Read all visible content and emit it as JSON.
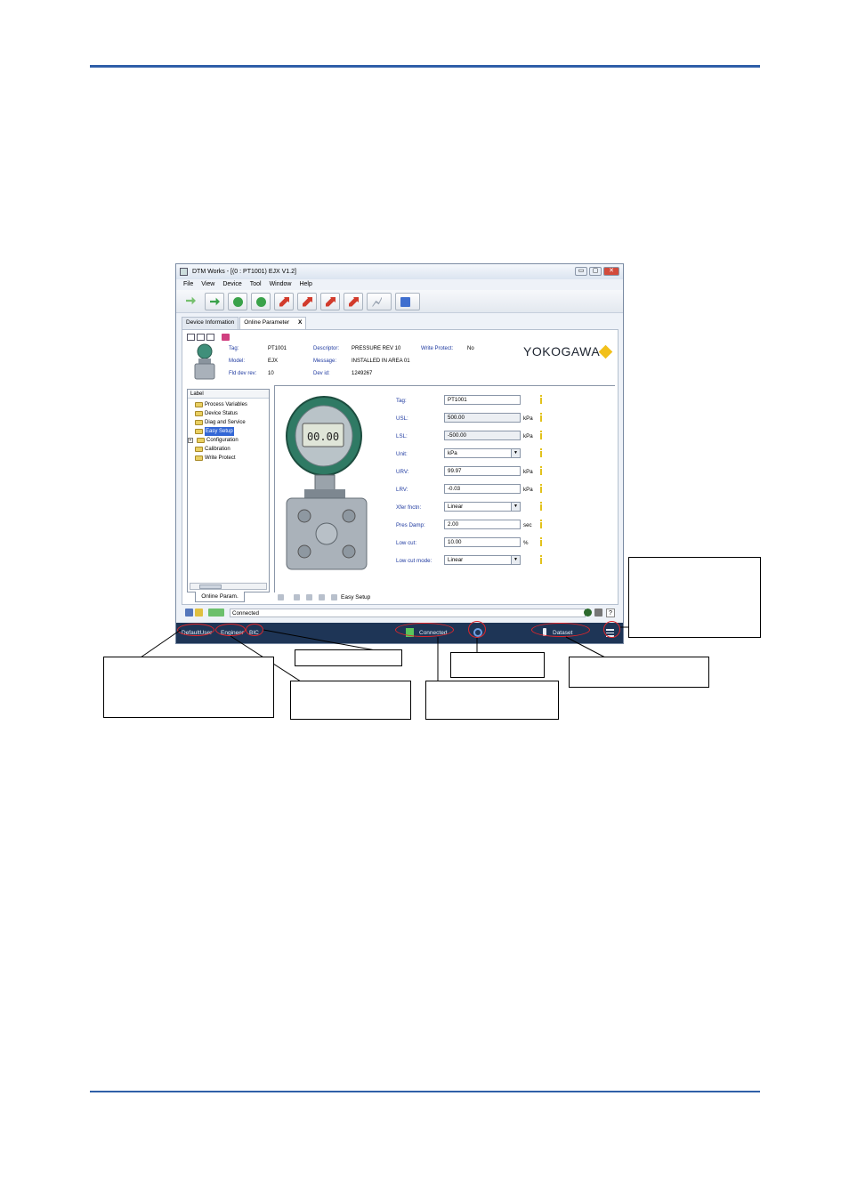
{
  "window": {
    "title": "DTM Works - [(0 : PT1001) EJX V1.2]",
    "controls": [
      "▭",
      "▢",
      "✕"
    ]
  },
  "menu": [
    "File",
    "View",
    "Device",
    "Tool",
    "Window",
    "Help"
  ],
  "tabs": {
    "device_information": "Device Information",
    "online_parameter": "Online Parameter",
    "close": "X"
  },
  "device_header": {
    "tag_label": "Tag:",
    "tag_value": "PT1001",
    "model_label": "Model:",
    "model_value": "EJX",
    "fld_dev_rev_label": "Fld dev rev:",
    "fld_dev_rev_value": "10",
    "descriptor_label": "Descriptor:",
    "descriptor_value": "PRESSURE REV 10",
    "message_label": "Message:",
    "message_value": "INSTALLED IN AREA 01",
    "dev_id_label": "Dev id:",
    "dev_id_value": "1249267",
    "write_protect_label": "Write Protect:",
    "write_protect_value": "No",
    "brand": "YOKOGAWA",
    "brand_color": "#f2c01a"
  },
  "tree": {
    "header": "Label",
    "items": [
      {
        "label": "Process Variables"
      },
      {
        "label": "Device Status"
      },
      {
        "label": "Diag and Service"
      },
      {
        "label": "Easy Setup",
        "selected": true
      },
      {
        "label": "Configuration",
        "expandable": true
      },
      {
        "label": "Calibration"
      },
      {
        "label": "Write Protect"
      }
    ],
    "bottom_tab": "Online Param."
  },
  "display_reading": "00.00",
  "params": [
    {
      "label": "Tag:",
      "value": "PT1001",
      "unit": ""
    },
    {
      "label": "USL:",
      "value": "500.00",
      "unit": "kPa"
    },
    {
      "label": "LSL:",
      "value": "-500.00",
      "unit": "kPa"
    },
    {
      "label": "Unit:",
      "value": "kPa",
      "unit": ""
    },
    {
      "label": "URV:",
      "value": "99.97",
      "unit": "kPa"
    },
    {
      "label": "LRV:",
      "value": "-0.03",
      "unit": "kPa"
    },
    {
      "label": "Xfer fnctn:",
      "value": "Linear",
      "unit": ""
    },
    {
      "label": "Pres Damp:",
      "value": "2.00",
      "unit": "sec"
    },
    {
      "label": "Low cut:",
      "value": "10.00",
      "unit": "%"
    },
    {
      "label": "Low cut mode:",
      "value": "Linear",
      "unit": ""
    }
  ],
  "nav": {
    "location": "Easy Setup"
  },
  "status_strip": {
    "text": "Connected",
    "help": "?"
  },
  "app_status": {
    "user": "DefaultUser",
    "role": "Engineer",
    "mode": "BIC",
    "connection": "Connected",
    "dataset": "Dataset",
    "accent_color": "#1e3556",
    "highlight_color": "#e0262b"
  }
}
